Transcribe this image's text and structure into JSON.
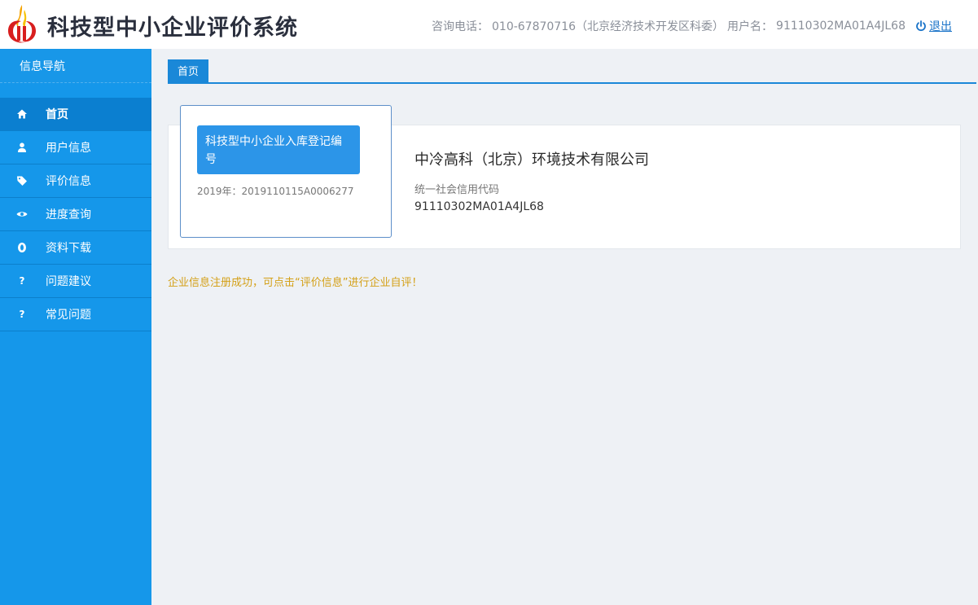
{
  "header": {
    "app_title": "科技型中小企业评价系统",
    "phone_label": "咨询电话：",
    "phone_value": "010-67870716（北京经济技术开发区科委）",
    "user_label": "用户名：",
    "user_value": "91110302MA01A4JL68",
    "logout_label": "退出"
  },
  "sidebar": {
    "title": "信息导航",
    "items": [
      {
        "label": "首页",
        "icon": "home-icon",
        "active": true
      },
      {
        "label": "用户信息",
        "icon": "user-icon"
      },
      {
        "label": "评价信息",
        "icon": "tag-icon"
      },
      {
        "label": "进度查询",
        "icon": "eye-icon"
      },
      {
        "label": "资料下载",
        "icon": "circle-icon"
      },
      {
        "label": "问题建议",
        "icon": "question-icon"
      },
      {
        "label": "常见问题",
        "icon": "question-icon"
      }
    ]
  },
  "tabs": [
    {
      "label": "首页",
      "active": true
    }
  ],
  "registration": {
    "button_label": "科技型中小企业入库登记编号",
    "number": "2019年：2019110115A0006277"
  },
  "company": {
    "name": "中冷高科（北京）环境技术有限公司",
    "credit_label": "统一社会信用代码",
    "credit_code": "91110302MA01A4JL68"
  },
  "notice": "企业信息注册成功，可点击“评价信息”进行企业自评！",
  "colors": {
    "sidebar": "#1597ea",
    "active_nav": "#0b7fd0",
    "accent": "#1a88d8",
    "notice": "#d4a017"
  }
}
